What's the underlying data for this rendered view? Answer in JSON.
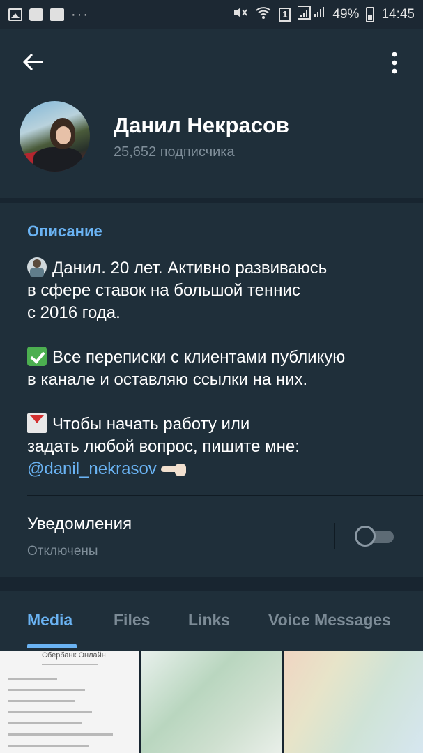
{
  "status_bar": {
    "dots": "···",
    "sim": "1",
    "battery": "49%",
    "time": "14:45"
  },
  "header": {
    "channel_name": "Данил Некрасов",
    "subscribers": "25,652 подписчика",
    "icons": {
      "back": "arrow-left-icon",
      "menu": "more-vertical-icon"
    }
  },
  "description": {
    "label": "Описание",
    "paragraphs": [
      {
        "emoji": "technologist-emoji",
        "lines": [
          "Данил. 20 лет. Активно развиваюсь",
          "в сфере ставок на большой теннис",
          "с 2016 года."
        ]
      },
      {
        "emoji": "check-mark-button-emoji",
        "lines": [
          "Все переписки с клиентами публикую",
          "в канале и оставляю ссылки на них."
        ]
      },
      {
        "emoji": "envelope-with-arrow-emoji",
        "lines": [
          "Чтобы начать работу или",
          "задать любой вопрос, пишите мне:"
        ],
        "link": "@danil_nekrasov",
        "trailing_emoji": "backhand-index-pointing-left-emoji"
      }
    ]
  },
  "notifications": {
    "title": "Уведомления",
    "status": "Отключены",
    "enabled": false
  },
  "tabs": {
    "items": [
      "Media",
      "Files",
      "Links",
      "Voice Messages"
    ],
    "active": "Media"
  },
  "media": {
    "doc_title": "Сбербанк Онлайн"
  },
  "colors": {
    "accent": "#6ab3f3",
    "background": "#182530",
    "panel": "#1f2f3a",
    "secondary_text": "#7f8e99"
  }
}
